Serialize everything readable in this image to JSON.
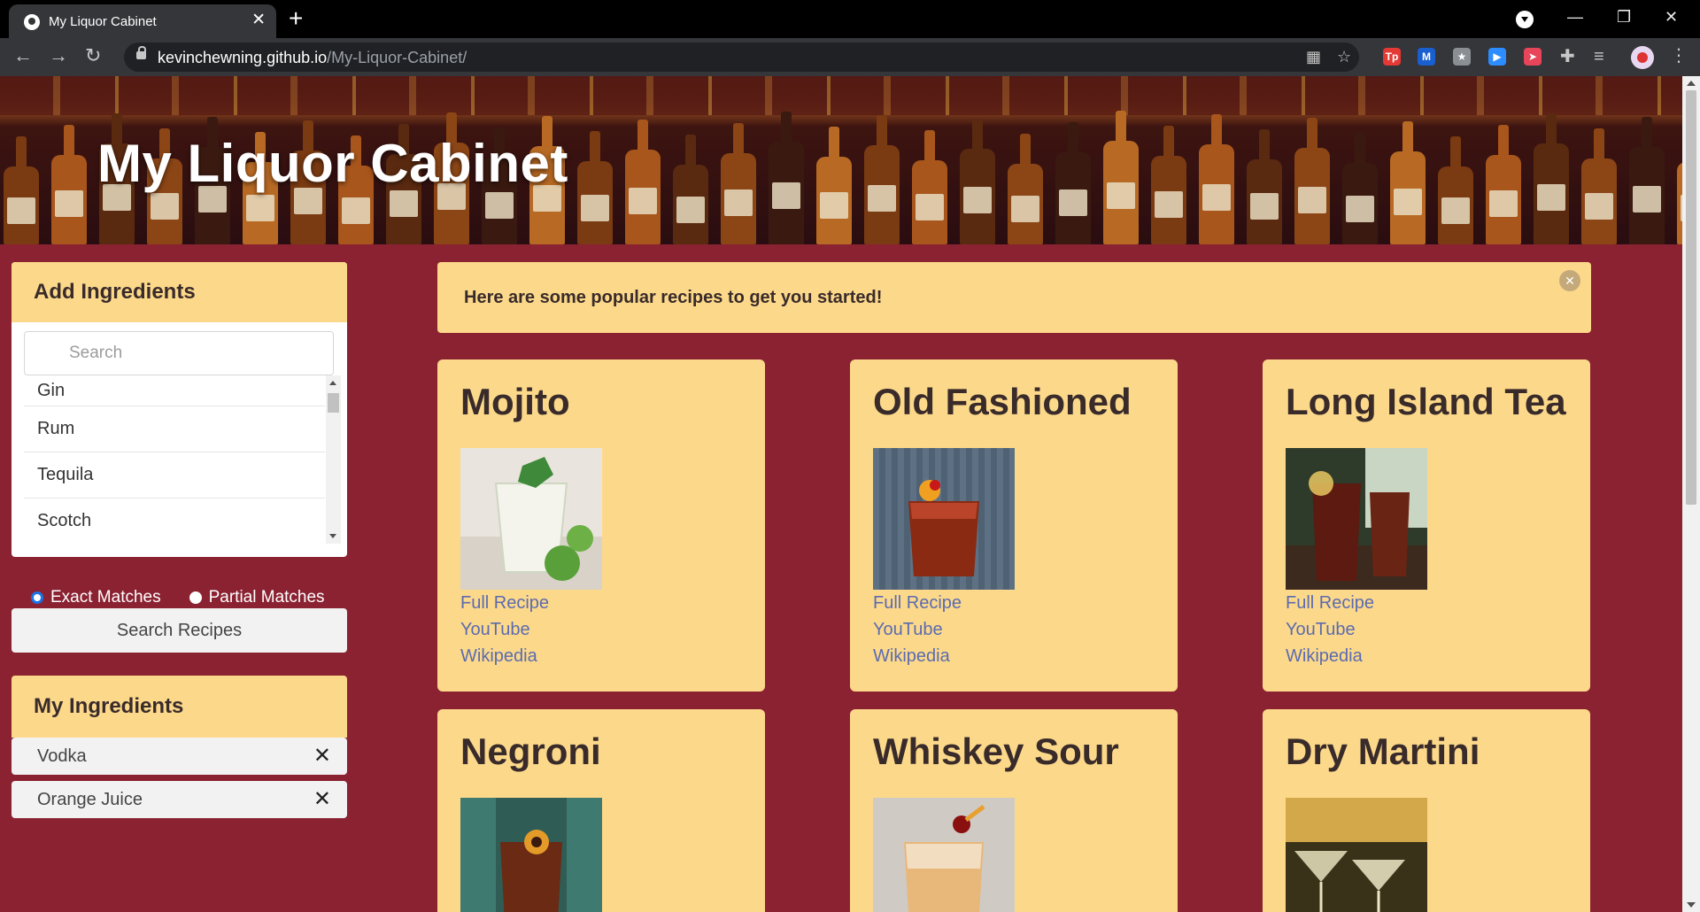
{
  "browser": {
    "tab_title": "My Liquor Cabinet",
    "tab_close": "✕",
    "new_tab": "+",
    "url_host": "kevinchewning.github.io",
    "url_path": "/My-Liquor-Cabinet/",
    "back": "←",
    "forward": "→",
    "reload": "↻",
    "minimize": "—",
    "restore": "❐",
    "close": "✕",
    "extensions": [
      {
        "icon": "tp-extension-icon",
        "glyph": "Tp",
        "color": "#e53935"
      },
      {
        "icon": "m-extension-icon",
        "glyph": "M",
        "color": "#1a5fd0"
      },
      {
        "icon": "puzzle-extension-icon",
        "glyph": "★",
        "color": "#8a8f94"
      },
      {
        "icon": "zoom-extension-icon",
        "glyph": "▶",
        "color": "#2d8cff"
      },
      {
        "icon": "red-extension-icon",
        "glyph": "➤",
        "color": "#e8455a"
      }
    ]
  },
  "banner": {
    "title": "My Liquor Cabinet"
  },
  "add_ingredients": {
    "title": "Add Ingredients",
    "search_placeholder": "Search",
    "items": [
      "Gin",
      "Rum",
      "Tequila",
      "Scotch"
    ]
  },
  "match_mode": {
    "exact_label": "Exact Matches",
    "partial_label": "Partial Matches",
    "selected": "exact"
  },
  "search_button": "Search Recipes",
  "my_ingredients": {
    "title": "My Ingredients",
    "items": [
      "Vodka",
      "Orange Juice"
    ],
    "remove_glyph": "✕"
  },
  "alert": {
    "text": "Here are some popular recipes to get you started!",
    "close": "✕"
  },
  "recipes": [
    {
      "name": "Mojito",
      "links": [
        "Full Recipe",
        "YouTube",
        "Wikipedia"
      ]
    },
    {
      "name": "Old Fashioned",
      "links": [
        "Full Recipe",
        "YouTube",
        "Wikipedia"
      ]
    },
    {
      "name": "Long Island Tea",
      "links": [
        "Full Recipe",
        "YouTube",
        "Wikipedia"
      ]
    },
    {
      "name": "Negroni",
      "links": []
    },
    {
      "name": "Whiskey Sour",
      "links": []
    },
    {
      "name": "Dry Martini",
      "links": []
    }
  ],
  "colors": {
    "page_bg": "#8b2232",
    "card_header": "#fcd98a",
    "link": "#5b6bb0",
    "text_dark": "#3a2b2b"
  }
}
